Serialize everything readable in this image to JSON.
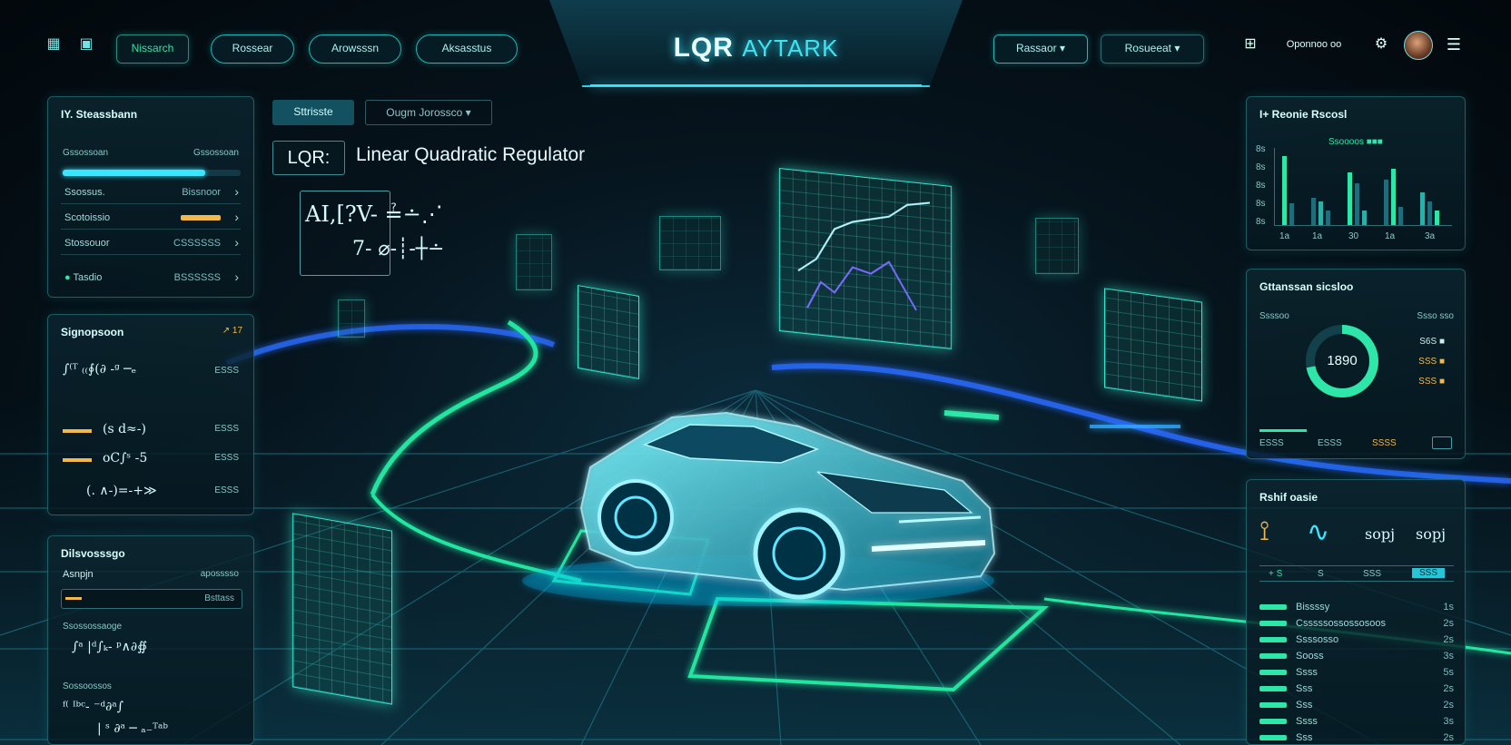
{
  "header": {
    "brand_main": "LQR",
    "brand_sub": "AYTARK",
    "left_tab": "Nissarch",
    "nav": [
      "Rossear",
      "Arowsssn",
      "Aksasstus"
    ],
    "right_select_1": "Rassaor",
    "right_select_2": "Rosueeat",
    "user_label": "Oponnoo oo"
  },
  "main": {
    "tabs": [
      "Sttrisste",
      "Ougm Jorossco"
    ],
    "lqr_label": "LQR:",
    "title": "Linear Quadratic Regulator",
    "formula_line1": "AI,[?V- ≟∸⋰",
    "formula_line2": "7- ⌀-┊-┼∸"
  },
  "left_panel_1": {
    "title": "IY. Steassbann",
    "progress_label": "Gssossoan",
    "progress_value_label": "Gssossoan",
    "progress_fraction": 0.8,
    "rows": [
      {
        "label": "Ssossus.",
        "value": "Bissnoor"
      },
      {
        "label": "Scotoissio",
        "value": ""
      },
      {
        "label": "Stossouor",
        "value": "CSSSSSS"
      },
      {
        "label": "Tasdio",
        "value": "BSSSSSS"
      }
    ]
  },
  "left_panel_2": {
    "title": "Signopsoon",
    "corner": "↗ 17",
    "eq": [
      "∫⁽ᵀ ₍₍∮(∂ -ᵍ ─ₑ",
      "(s d≈-)",
      "oC∫ˢ -5",
      "(. ∧-)=-+≫"
    ],
    "tags": [
      "ESSS",
      "ESSS",
      "ESSS",
      "ESSS"
    ]
  },
  "left_panel_3": {
    "title": "Dilsvosssgo",
    "field_label": "Asnpjn",
    "field_value": "aposssso",
    "input_value": "Bsttass",
    "eq": [
      "∫ᵃ |ᵈ∫ₖ- ᵖ∧∂∯",
      "ᶠ⁽ ᴵᵇᶜ- ⁻ᵈ∂ᵃ∫",
      "| ˢ ∂ᵃ ─ ₐ₋ᵀᵃᵇ"
    ],
    "tags": [
      "Ssossossaoge",
      "Sossoossos"
    ]
  },
  "right_panel_1": {
    "title": "I+ Reonie Rscosl",
    "legend": "Ssoooos  ■■■",
    "x_labels": [
      "1a",
      "1a",
      "30",
      "1a",
      "3a"
    ],
    "y_labels": [
      "8s",
      "8s",
      "8s",
      "8s",
      "8s"
    ]
  },
  "right_panel_2": {
    "title": "Gttanssan sicsloo",
    "gauge_value": "1890",
    "gauge_fraction": 0.72,
    "left_label": "Ssssoo",
    "legend": [
      "Ssso sso",
      "S6S ■",
      "SSS ■",
      "SSS ■"
    ],
    "footer": [
      "ESSS",
      "ESSS",
      "SSSS"
    ]
  },
  "right_panel_3": {
    "title": "Rshif oasie",
    "icons_caption": [
      "sopj",
      "sopj"
    ],
    "chips": [
      "+ S",
      "S",
      "SSS",
      "SSS"
    ],
    "rows": [
      {
        "label": "Bissssy",
        "value": "1s"
      },
      {
        "label": "Csssssossossosoos",
        "value": "2s"
      },
      {
        "label": "Ssssosso",
        "value": "2s"
      },
      {
        "label": "Sooss",
        "value": "3s"
      },
      {
        "label": "Ssss",
        "value": "5s"
      },
      {
        "label": "Sss",
        "value": "2s"
      },
      {
        "label": "Sss",
        "value": "2s"
      },
      {
        "label": "Ssss",
        "value": "3s"
      },
      {
        "label": "Sss",
        "value": "2s"
      }
    ]
  },
  "colors": {
    "accent": "#38e6ff",
    "green": "#2ee6a8",
    "orange": "#f2b94a"
  }
}
